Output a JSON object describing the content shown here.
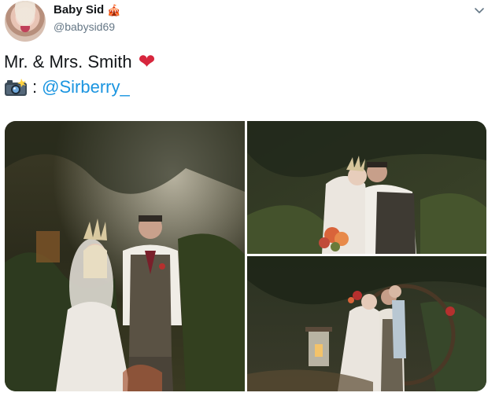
{
  "author": {
    "display_name": "Baby Sid",
    "name_emoji": "🎪",
    "handle": "@babysid69",
    "avatar_icon": "profile-avatar"
  },
  "tweet": {
    "line1": "Mr. & Mrs. Smith",
    "line1_emoji": "❤",
    "line2_emoji": "📸",
    "line2_colon": ":",
    "mention": "@Sirberry_"
  },
  "menu_icon": "chevron-down-icon",
  "colors": {
    "text": "#14171a",
    "secondary": "#657786",
    "link": "#1b95e0",
    "heart": "#d7263d"
  },
  "photos": [
    {
      "label": "wedding-photo-couple-standing"
    },
    {
      "label": "wedding-photo-couple-kissing"
    },
    {
      "label": "wedding-photo-couple-arch"
    }
  ]
}
